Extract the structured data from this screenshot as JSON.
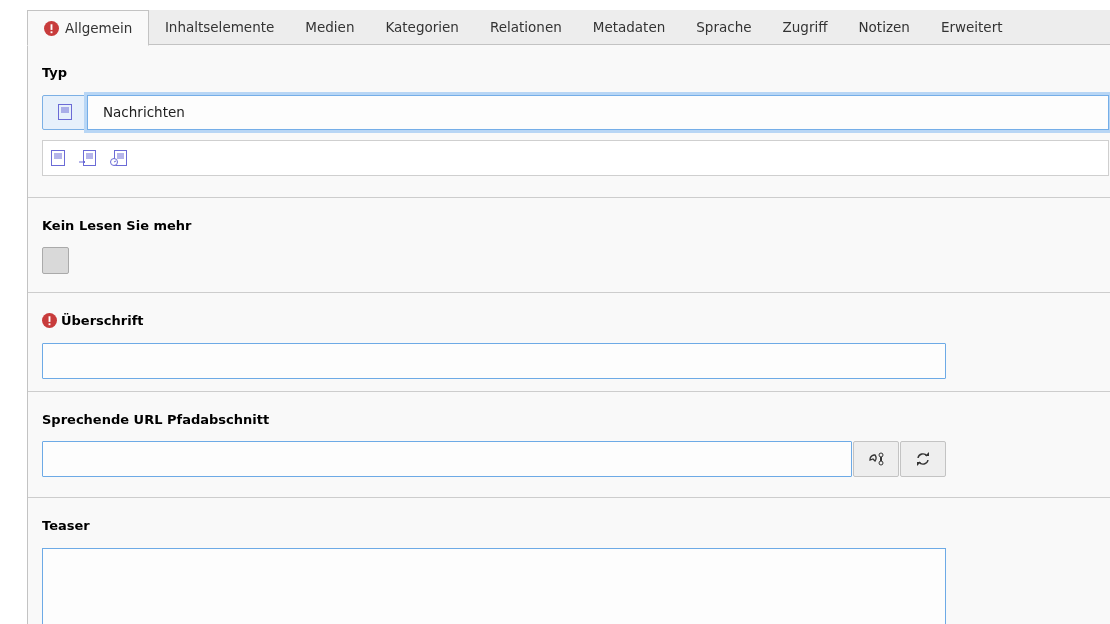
{
  "tabs": [
    {
      "label": "Allgemein",
      "selected": true,
      "has_error": true
    },
    {
      "label": "Inhaltselemente",
      "selected": false,
      "has_error": false
    },
    {
      "label": "Medien",
      "selected": false,
      "has_error": false
    },
    {
      "label": "Kategorien",
      "selected": false,
      "has_error": false
    },
    {
      "label": "Relationen",
      "selected": false,
      "has_error": false
    },
    {
      "label": "Metadaten",
      "selected": false,
      "has_error": false
    },
    {
      "label": "Sprache",
      "selected": false,
      "has_error": false
    },
    {
      "label": "Zugriff",
      "selected": false,
      "has_error": false
    },
    {
      "label": "Notizen",
      "selected": false,
      "has_error": false
    },
    {
      "label": "Erweitert",
      "selected": false,
      "has_error": false
    }
  ],
  "fields": [
    {
      "kind": "select",
      "label": "Typ",
      "value": "Nachrichten",
      "type_options": [
        {
          "kind": "page"
        },
        {
          "kind": "internal"
        },
        {
          "kind": "external"
        }
      ]
    },
    {
      "kind": "checkbox",
      "label": "Kein Lesen Sie mehr",
      "checked": false
    },
    {
      "kind": "text",
      "label": "Überschrift",
      "has_error": true
    },
    {
      "kind": "slug",
      "label": "Sprechende URL Pfadabschnitt"
    },
    {
      "kind": "textarea",
      "label": "Teaser"
    }
  ]
}
